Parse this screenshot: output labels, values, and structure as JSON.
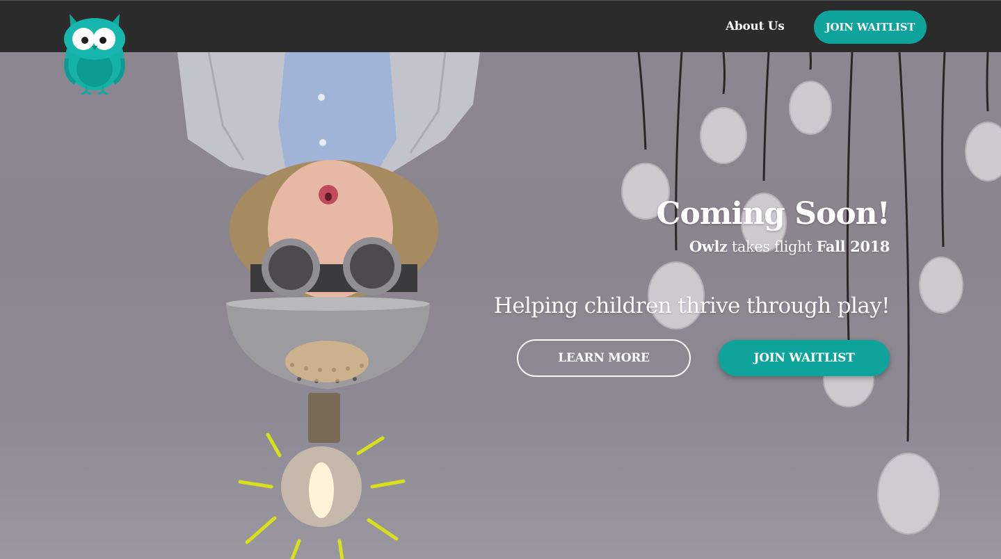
{
  "brand": {
    "logo_icon": "owl-logo-icon",
    "accent_color": "#0ea39b"
  },
  "nav": {
    "about_label": "About Us",
    "waitlist_label": "JOIN WAITLIST"
  },
  "hero": {
    "title": "Coming Soon!",
    "sub_brand": "Owlz",
    "sub_mid": "takes flight",
    "sub_date": "Fall 2018",
    "tagline": "Helping children thrive through play!",
    "learn_more_label": "LEARN MORE",
    "waitlist_label": "JOIN WAITLIST",
    "background_image": "child-upside-down-with-goggles-and-lightbulb-image"
  }
}
